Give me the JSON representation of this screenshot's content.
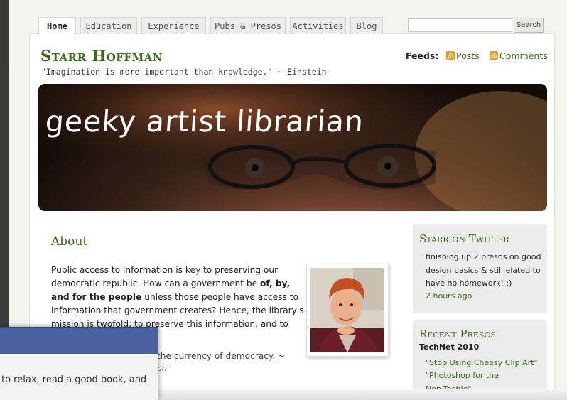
{
  "nav": {
    "tabs": [
      "Home",
      "Education",
      "Experience",
      "Pubs & Presos",
      "Activities",
      "Blog"
    ],
    "active_tab": "Home"
  },
  "search": {
    "button_label": "Search",
    "placeholder": ""
  },
  "header": {
    "site_title": "Starr Hoffman",
    "tagline": "\"Imagination is more important than knowledge.\" ~ Einstein",
    "feeds_label": "Feeds:",
    "feed_posts": "Posts",
    "feed_comments": "Comments"
  },
  "banner": {
    "text": "geeky artist librarian"
  },
  "about": {
    "title": "About",
    "p1_a": "Public access to information is key to preserving our democratic republic. How can a government be ",
    "p1_bold": "of, by, and for the people",
    "p1_b": " unless those people have access to information that government creates? Hence, the library's mission is twofold: to preserve this information, and to make",
    "p1_visible_tail": "the currency of democracy. ~",
    "p1_cite": "on"
  },
  "sidebar": {
    "twitter": {
      "title": "Starr on Twitter",
      "tweet": "finishing up 2 presos on good design basics & still elated to have no homework! :)",
      "time": "2 hours ago"
    },
    "presos": {
      "title": "Recent Presos",
      "subtitle": "TechNet 2010",
      "link1": "\"Stop Using Cheesy Clip Art\"",
      "link2": "\"Photoshop for the Non-Techie\""
    }
  },
  "overlay": {
    "text": "to relax, read a good book, and"
  },
  "colors": {
    "accent": "#3c6a1d",
    "rss": "#f29a1f",
    "overlay_bar": "#4a62a1"
  }
}
